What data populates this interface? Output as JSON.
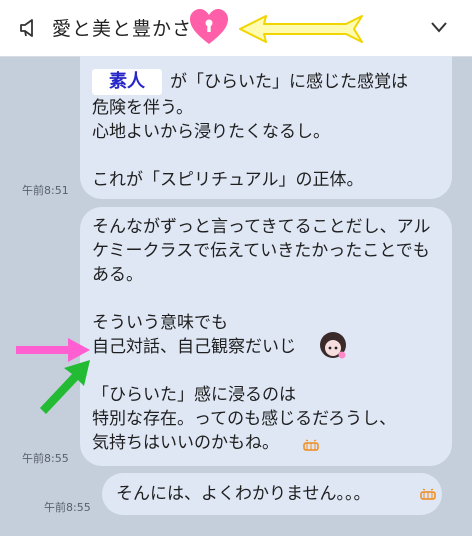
{
  "header": {
    "title": "愛と美と豊かさ",
    "megaphone_icon": "megaphone-icon",
    "chevron_icon": "chevron-down-icon",
    "colors": {
      "heart": "#ff5fa8",
      "arrow": "#ffee33"
    }
  },
  "messages": [
    {
      "badge": "素人",
      "first_line": "が「ひらいた」に感じた感覚は",
      "body": "危険を伴う。\n心地よいから浸りたくなるし。\n\nこれが「スピリチュアル」の正体。",
      "time": "午前8:51"
    },
    {
      "body": "そんながずっと言ってきてることだし、アルケミークラスで伝えていきたかったことでもある。\n\nそういう意味でも\n自己対話、自己観察だいじ\n\n「ひらいた」感に浸るのは\n特別な存在。ってのも感じるだろうし、\n気持ちはいいのかもね。",
      "time": "午前8:55"
    },
    {
      "body": "そんには、よくわかりません。。。",
      "time": "午前8:55"
    }
  ],
  "annotations": {
    "pink_arrow_color": "#ff5fd0",
    "green_arrow_color": "#22bb33"
  }
}
